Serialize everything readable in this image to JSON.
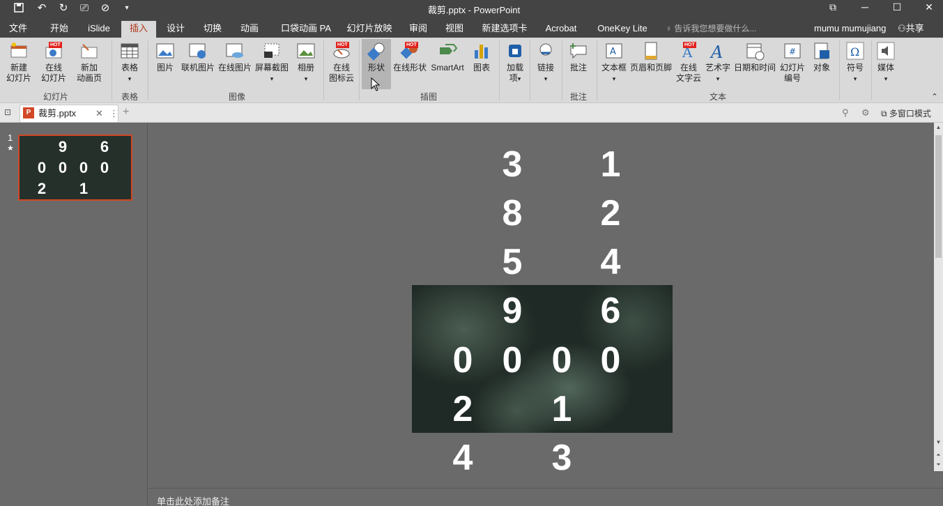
{
  "titlebar": {
    "title": "裁剪.pptx - PowerPoint"
  },
  "tabs": [
    "文件",
    "开始",
    "iSlide",
    "插入",
    "设计",
    "切换",
    "动画",
    "口袋动画 PA",
    "幻灯片放映",
    "审阅",
    "视图",
    "新建选项卡",
    "Acrobat",
    "OneKey Lite"
  ],
  "active_tab": "插入",
  "tell_me": "告诉我您想要做什么...",
  "user": "mumu mumujiang",
  "share": "共享",
  "ribbon": {
    "new_slide": "新建\n幻灯片",
    "online_slide": "在线\n幻灯片",
    "new_anim": "新加\n动画页",
    "table": "表格",
    "picture": "图片",
    "online_pic": "联机图片",
    "online_pic2": "在线图片",
    "screenshot": "屏幕截图",
    "album": "相册",
    "icon_cloud": "在线\n图标云",
    "shapes": "形状",
    "online_shapes": "在线形状",
    "smartart": "SmartArt",
    "chart": "图表",
    "addins": "加载\n项",
    "link": "链接",
    "comment": "批注",
    "textbox": "文本框",
    "headerfooter": "页眉和页脚",
    "online_text": "在线\n文字云",
    "wordart": "艺术字",
    "datetime": "日期和时间",
    "slide_number": "幻灯片\n编号",
    "object": "对象",
    "symbol": "符号",
    "media": "媒体",
    "hot": "HOT",
    "groups": {
      "slides": "幻灯片",
      "tables": "表格",
      "images": "图像",
      "illus": "插图",
      "addins_links": "",
      "comments": "批注",
      "text": "文本"
    }
  },
  "doc_tab": {
    "name": "裁剪.pptx",
    "multi_window": "多窗口模式"
  },
  "thumbnail": {
    "number": "1",
    "star": "★",
    "rows": [
      [
        "",
        "9",
        "",
        "6"
      ],
      [
        "0",
        "0",
        "0",
        "0"
      ],
      [
        "2",
        "",
        "1",
        ""
      ]
    ]
  },
  "slide_digits": {
    "col1": [
      "",
      "",
      "",
      "",
      "0",
      "2",
      "4"
    ],
    "col2": [
      "3",
      "8",
      "5",
      "9",
      "0",
      "",
      ""
    ],
    "col3": [
      "",
      "",
      "",
      "",
      "0",
      "1",
      "3"
    ],
    "col4": [
      "1",
      "2",
      "4",
      "6",
      "0",
      "",
      ""
    ]
  },
  "notes": "单击此处添加备注"
}
